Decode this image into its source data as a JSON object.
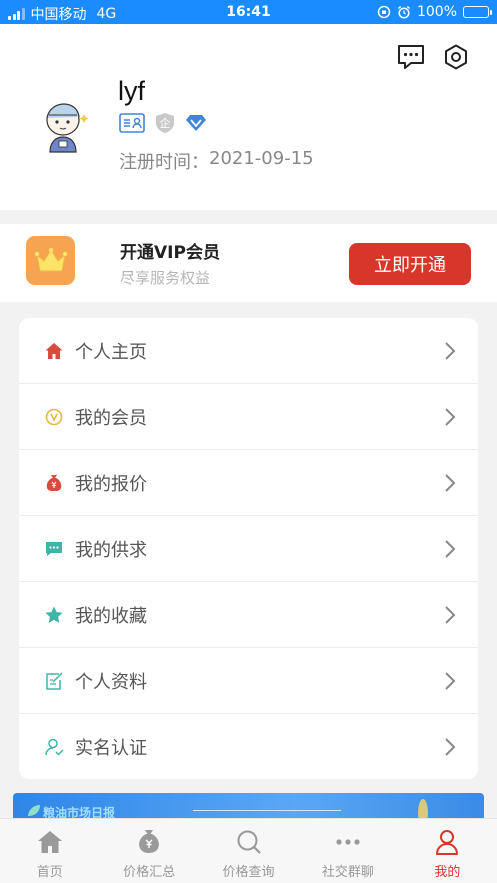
{
  "status_bar": {
    "carrier": "中国移动",
    "network": "4G",
    "time": "16:41",
    "battery": "100%"
  },
  "profile": {
    "username": "lyf",
    "reg_label": "注册时间：",
    "reg_date": "2021-09-15",
    "badges": [
      "id-card-badge",
      "enterprise-badge",
      "vip-diamond-badge"
    ],
    "badge_enterprise_text": "企"
  },
  "vip": {
    "title": "开通VIP会员",
    "subtitle": "尽享服务权益",
    "button": "立即开通"
  },
  "menu": {
    "items": [
      {
        "label": "个人主页",
        "icon": "home-icon",
        "color": "#d94b3d"
      },
      {
        "label": "我的会员",
        "icon": "member-icon",
        "color": "#e6b640"
      },
      {
        "label": "我的报价",
        "icon": "money-bag-icon",
        "color": "#d94b3d"
      },
      {
        "label": "我的供求",
        "icon": "chat-icon",
        "color": "#3fb5a8"
      },
      {
        "label": "我的收藏",
        "icon": "star-icon",
        "color": "#3fb5a8"
      },
      {
        "label": "个人资料",
        "icon": "edit-icon",
        "color": "#3fb5a8"
      },
      {
        "label": "实名认证",
        "icon": "user-verify-icon",
        "color": "#3fb5a8"
      }
    ]
  },
  "banner": {
    "text": "粮油市场日报"
  },
  "tabbar": {
    "tabs": [
      {
        "label": "首页",
        "icon": "home-icon",
        "active": false
      },
      {
        "label": "价格汇总",
        "icon": "money-bag-icon",
        "active": false
      },
      {
        "label": "价格查询",
        "icon": "search-icon",
        "active": false
      },
      {
        "label": "社交群聊",
        "icon": "more-dots-icon",
        "active": false
      },
      {
        "label": "我的",
        "icon": "user-icon",
        "active": true
      }
    ]
  },
  "colors": {
    "status_bar": "#1a8cff",
    "accent_red": "#d8362a",
    "crown_bg": "#f6a452"
  }
}
